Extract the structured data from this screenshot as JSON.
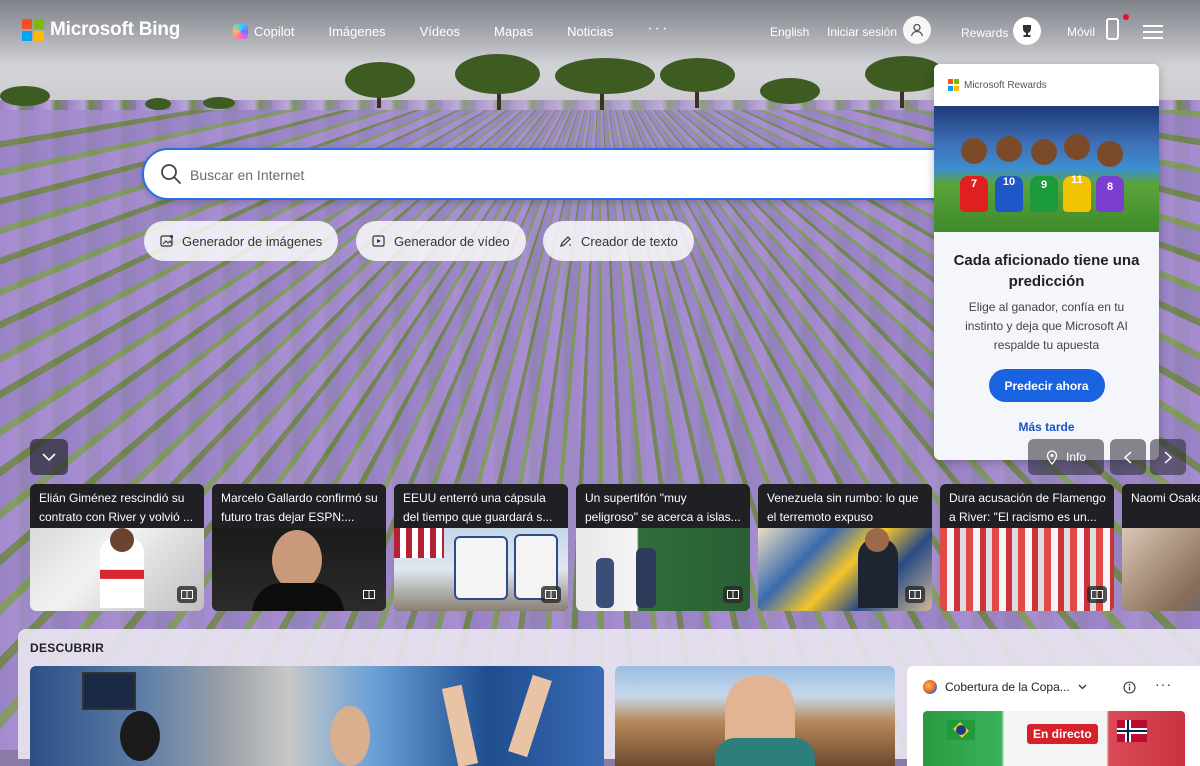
{
  "header": {
    "logo_text": "Microsoft Bing",
    "nav": [
      {
        "label": "Copilot",
        "icon": "copilot-icon"
      },
      {
        "label": "Imágenes"
      },
      {
        "label": "Vídeos"
      },
      {
        "label": "Mapas"
      },
      {
        "label": "Noticias"
      },
      {
        "label": "···"
      }
    ],
    "language": "English",
    "signin": "Iniciar sesión",
    "rewards": "Rewards",
    "mobile": "Móvil"
  },
  "search": {
    "placeholder": "Buscar en Internet"
  },
  "tools": [
    {
      "label": "Generador de imágenes",
      "icon": "image-sparkle-icon"
    },
    {
      "label": "Generador de vídeo",
      "icon": "video-sparkle-icon"
    },
    {
      "label": "Creador de texto",
      "icon": "pen-sparkle-icon"
    }
  ],
  "rewards_card": {
    "brand": "Microsoft Rewards",
    "title": "Cada aficionado tiene una predicción",
    "body": "Elige al ganador, confía en tu instinto y deja que Microsoft AI respalde tu apuesta",
    "cta": "Predecir ahora",
    "later": "Más tarde",
    "player_numbers": [
      "7",
      "10",
      "9",
      "11",
      "8"
    ]
  },
  "info_label": "Info",
  "news": [
    {
      "title": "Elián Giménez rescindió su contrato con River y volvió ..."
    },
    {
      "title": "Marcelo Gallardo confirmó su futuro tras dejar ESPN:..."
    },
    {
      "title": "EEUU enterró una cápsula del tiempo que guardará s..."
    },
    {
      "title": "Un supertifón \"muy peligroso\" se acerca a islas..."
    },
    {
      "title": "Venezuela sin rumbo: lo que el terremoto expuso"
    },
    {
      "title": "Dura acusación de Flamengo a River: \"El racismo es un..."
    },
    {
      "title": "Naomi Osaka Sabalenka"
    }
  ],
  "discover": {
    "title": "DESCUBRIR",
    "copa_title": "Cobertura de la Copa...",
    "live_badge": "En directo"
  },
  "colors": {
    "accent_blue": "#1a63e0",
    "ms_red": "#f25022",
    "ms_green": "#7fba00",
    "ms_blue": "#00a4ef",
    "ms_yellow": "#ffb900",
    "live_red": "#d6202c"
  }
}
